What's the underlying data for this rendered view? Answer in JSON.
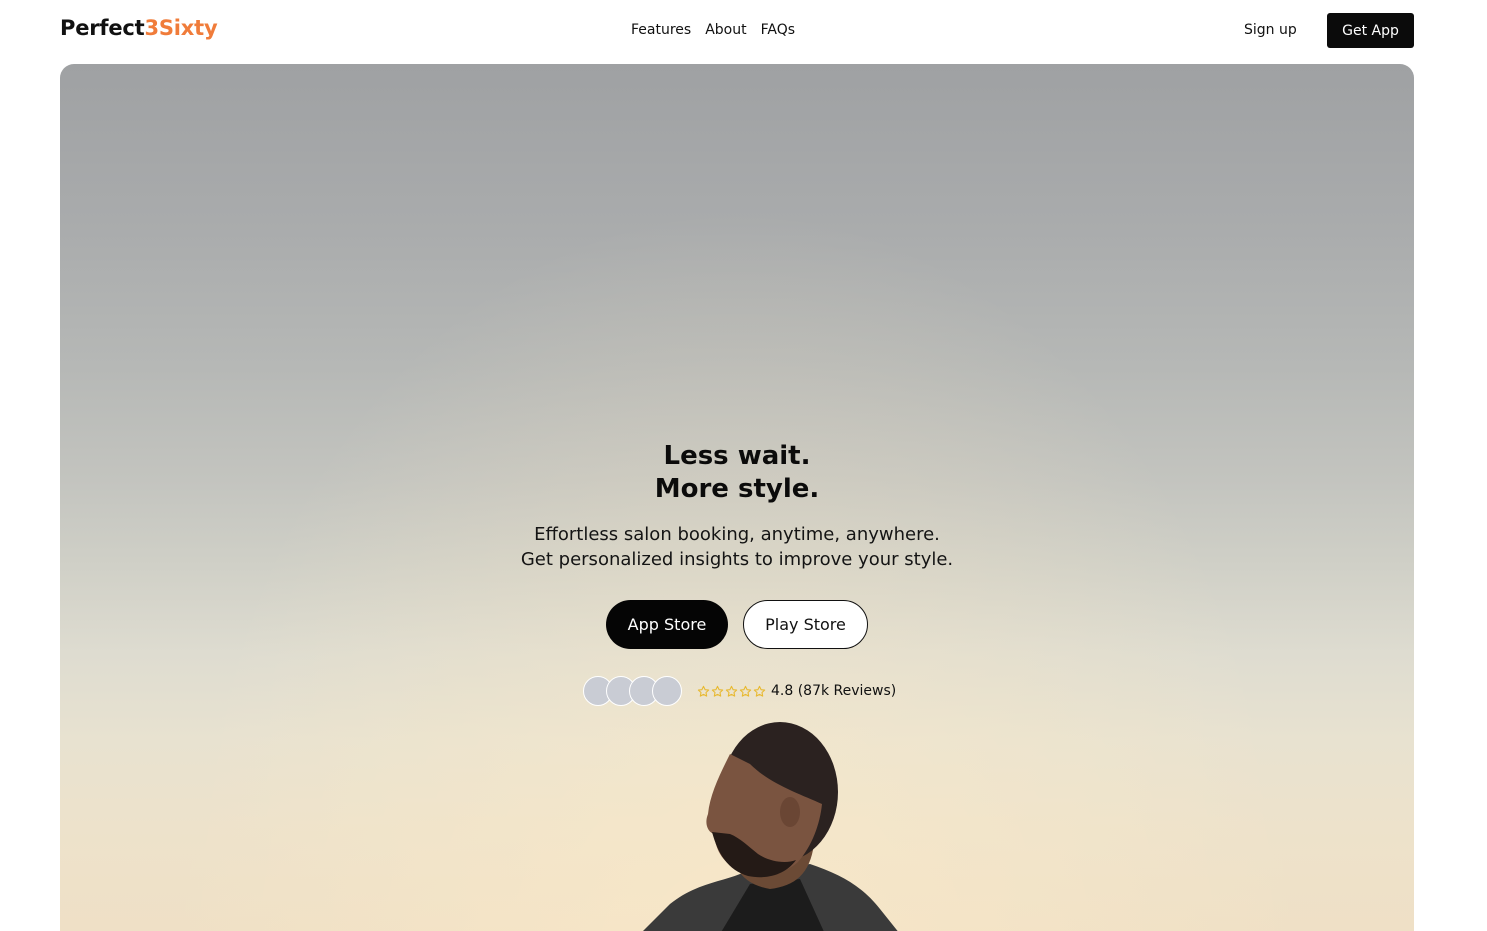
{
  "header": {
    "logo_part1": "Perfect",
    "logo_part2": "3Sixty",
    "nav": [
      "Features",
      "About",
      "FAQs"
    ],
    "signup_label": "Sign up",
    "getapp_label": "Get App"
  },
  "hero": {
    "headline_line1": "Less wait.",
    "headline_line2": "More style.",
    "subtitle_line1": "Effortless salon booking, anytime, anywhere.",
    "subtitle_line2": "Get personalized insights to improve your style.",
    "appstore_label": "App Store",
    "playstore_label": "Play Store",
    "rating_text": "4.8 (87k Reviews)",
    "star_count": 5,
    "avatar_count": 4
  },
  "colors": {
    "brand_accent": "#F07C3A",
    "primary_button": "#0B0B0B",
    "star": "#E8B931"
  },
  "icons": {
    "star": "star-outline-icon"
  }
}
